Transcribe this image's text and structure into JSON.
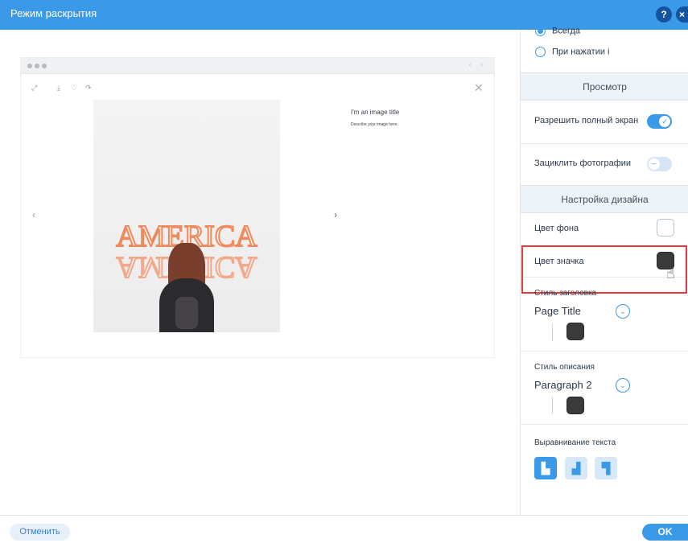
{
  "window": {
    "title": "Режим раскрытия",
    "help_label": "?",
    "close_label": "×"
  },
  "preview": {
    "image_title": "I'm an image title",
    "image_description": "Describe your image here.",
    "neon_text": "AMERICA"
  },
  "panel": {
    "open_mode": {
      "options": [
        {
          "label": "Всегда",
          "selected": true
        },
        {
          "label": "При нажатии і",
          "selected": false
        }
      ]
    },
    "view_section": {
      "title": "Просмотр"
    },
    "allow_fullscreen": {
      "label": "Разрешить полный экран",
      "enabled": true
    },
    "loop_photos": {
      "label": "Зациклить фотографии",
      "enabled": false
    },
    "design_section": {
      "title": "Настройка дизайна"
    },
    "bg_color": {
      "label": "Цвет фона",
      "color": "#ffffff"
    },
    "icon_color": {
      "label": "Цвет значка",
      "color": "#3a3a3a"
    },
    "title_style": {
      "label": "Стиль заголовка",
      "font": "Page Title",
      "color": "#3a3a3a"
    },
    "desc_style": {
      "label": "Стиль описания",
      "font": "Paragraph 2",
      "color": "#3a3a3a"
    },
    "text_align": {
      "label": "Выравнивание текста",
      "options": [
        "left",
        "center",
        "right"
      ],
      "selected": "left"
    }
  },
  "footer": {
    "cancel_label": "Отменить",
    "ok_label": "OK"
  },
  "colors": {
    "accent": "#3b9ae8",
    "highlight": "#e43a3a"
  }
}
